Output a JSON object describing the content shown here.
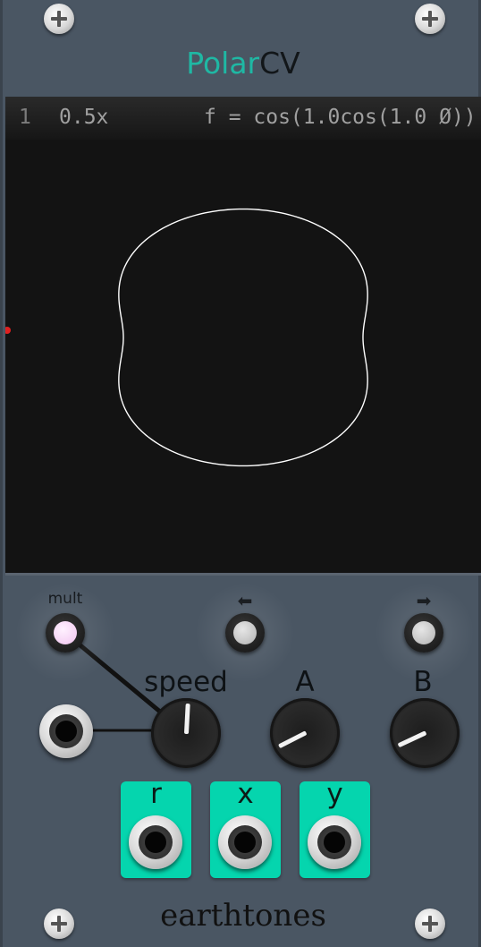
{
  "module": {
    "title_part1": "Polar",
    "title_part2": "CV",
    "brand": "earthtones"
  },
  "display": {
    "line_number": "1",
    "multiplier": "0.5x",
    "formula": "f = cos(1.0cos(1.0 Ø))",
    "curve_color": "#ffffff",
    "marker_color": "#e02020"
  },
  "controls": {
    "mult_label": "mult",
    "left_button_label": "⬅",
    "right_button_label": "➡",
    "knobs": [
      {
        "label": "speed"
      },
      {
        "label": "A"
      },
      {
        "label": "B"
      }
    ],
    "outputs": [
      {
        "label": "r"
      },
      {
        "label": "x"
      },
      {
        "label": "y"
      }
    ],
    "accent_color": "#05d5ae"
  }
}
